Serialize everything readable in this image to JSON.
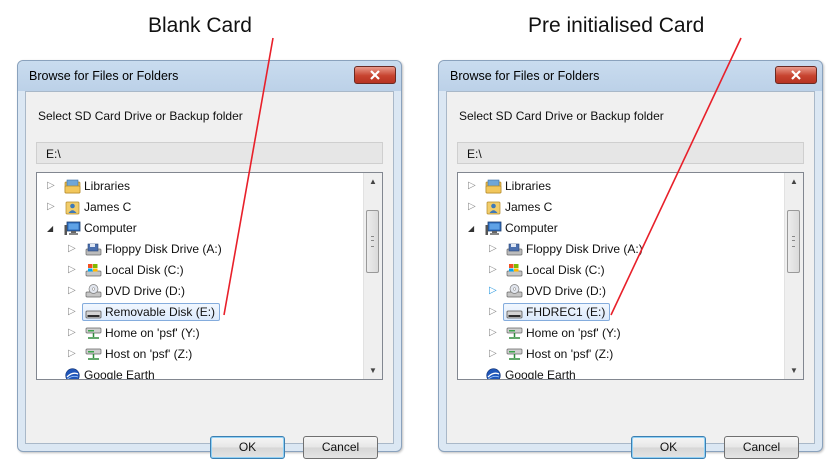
{
  "captions": {
    "left": "Blank Card",
    "right": "Pre initialised Card"
  },
  "colors": {
    "annotation_line": "#e8202a",
    "selection_border": "#84acdd",
    "close_button": "#c7432f"
  },
  "dialogs": [
    {
      "title": "Browse for Files or Folders",
      "instruction": "Select SD Card Drive or Backup folder",
      "path": "E:\\",
      "items": [
        {
          "label": "Libraries",
          "icon": "libraries-icon",
          "level": 0,
          "expander": "collapsed"
        },
        {
          "label": "James C",
          "icon": "user-folder-icon",
          "level": 0,
          "expander": "collapsed"
        },
        {
          "label": "Computer",
          "icon": "computer-icon",
          "level": 0,
          "expander": "expanded"
        },
        {
          "label": "Floppy Disk Drive (A:)",
          "icon": "floppy-drive-icon",
          "level": 1,
          "expander": "collapsed"
        },
        {
          "label": "Local Disk (C:)",
          "icon": "local-disk-icon",
          "level": 1,
          "expander": "collapsed"
        },
        {
          "label": "DVD Drive (D:)",
          "icon": "dvd-drive-icon",
          "level": 1,
          "expander": "collapsed"
        },
        {
          "label": "Removable Disk (E:)",
          "icon": "removable-disk-icon",
          "level": 1,
          "expander": "collapsed",
          "selected": true
        },
        {
          "label": "Home on 'psf' (Y:)",
          "icon": "network-drive-icon",
          "level": 1,
          "expander": "collapsed"
        },
        {
          "label": "Host on 'psf' (Z:)",
          "icon": "network-drive-icon",
          "level": 1,
          "expander": "collapsed"
        },
        {
          "label": "Google Earth",
          "icon": "google-earth-icon",
          "level": 0,
          "expander": "none"
        }
      ],
      "buttons": {
        "ok": "OK",
        "cancel": "Cancel"
      }
    },
    {
      "title": "Browse for Files or Folders",
      "instruction": "Select SD Card Drive or Backup folder",
      "path": "E:\\",
      "items": [
        {
          "label": "Libraries",
          "icon": "libraries-icon",
          "level": 0,
          "expander": "collapsed"
        },
        {
          "label": "James C",
          "icon": "user-folder-icon",
          "level": 0,
          "expander": "collapsed"
        },
        {
          "label": "Computer",
          "icon": "computer-icon",
          "level": 0,
          "expander": "expanded"
        },
        {
          "label": "Floppy Disk Drive (A:)",
          "icon": "floppy-drive-icon",
          "level": 1,
          "expander": "collapsed"
        },
        {
          "label": "Local Disk (C:)",
          "icon": "local-disk-icon",
          "level": 1,
          "expander": "collapsed"
        },
        {
          "label": "DVD Drive (D:)",
          "icon": "dvd-drive-icon",
          "level": 1,
          "expander": "collapsed-hot"
        },
        {
          "label": "FHDREC1 (E:)",
          "icon": "removable-disk-icon",
          "level": 1,
          "expander": "collapsed",
          "selected": true
        },
        {
          "label": "Home on 'psf' (Y:)",
          "icon": "network-drive-icon",
          "level": 1,
          "expander": "collapsed"
        },
        {
          "label": "Host on 'psf' (Z:)",
          "icon": "network-drive-icon",
          "level": 1,
          "expander": "collapsed"
        },
        {
          "label": "Google Earth",
          "icon": "google-earth-icon",
          "level": 0,
          "expander": "none"
        }
      ],
      "buttons": {
        "ok": "OK",
        "cancel": "Cancel"
      }
    }
  ]
}
